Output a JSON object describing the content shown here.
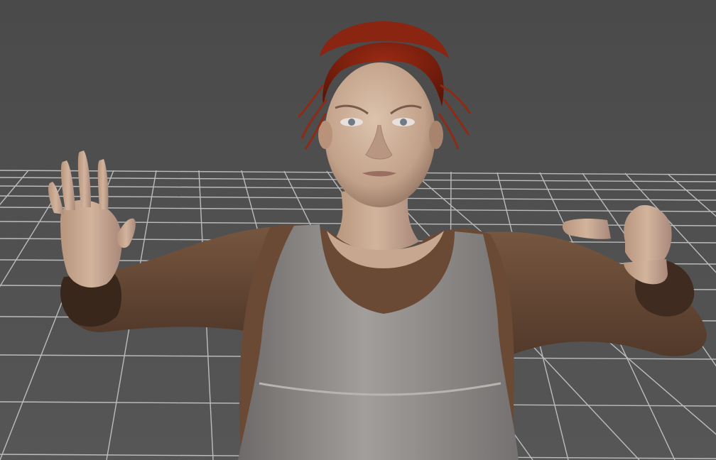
{
  "viewport": {
    "background_color": "#4b4b4b",
    "grid_color": "#d8d8d8"
  },
  "figure": {
    "hair_color": "#7a1f10",
    "skin_color": "#c9a88e",
    "top_color": "#6a4a35",
    "dress_color": "#8e8a88"
  }
}
